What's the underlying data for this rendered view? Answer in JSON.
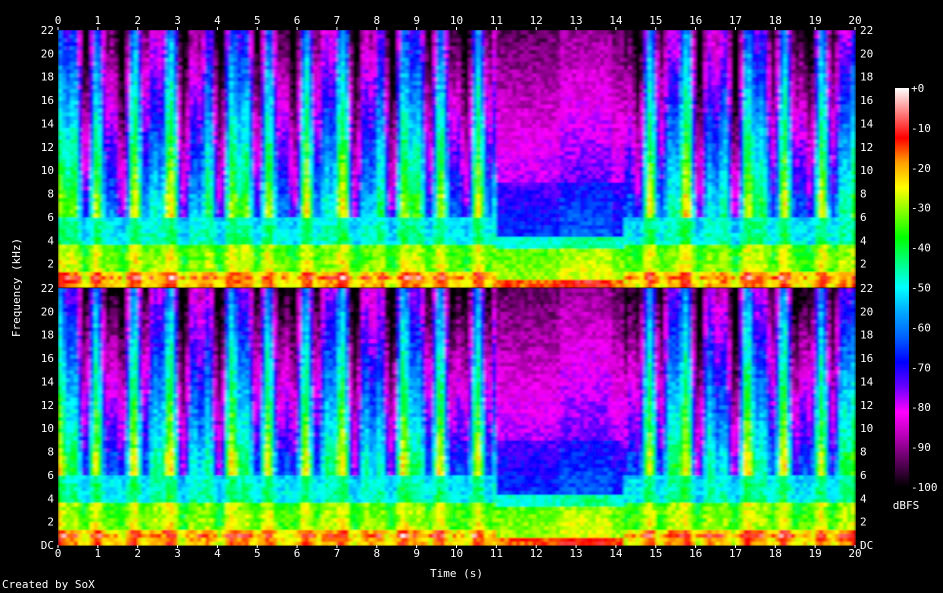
{
  "credit": "Created by SoX",
  "chart_data": {
    "type": "heatmap",
    "subtype": "spectrogram",
    "channels": 2,
    "xlabel": "Time (s)",
    "ylabel": "Frequency (kHz)",
    "xlim": [
      0,
      20
    ],
    "ylim": [
      0,
      22
    ],
    "x_ticks": [
      "0",
      "1",
      "2",
      "3",
      "4",
      "5",
      "6",
      "7",
      "8",
      "9",
      "10",
      "11",
      "12",
      "13",
      "14",
      "15",
      "16",
      "17",
      "18",
      "19",
      "20"
    ],
    "y_ticks": [
      "DC",
      "2",
      "4",
      "6",
      "8",
      "10",
      "12",
      "14",
      "16",
      "18",
      "20",
      "22"
    ],
    "colorbar": {
      "label": "dBFS",
      "range": [
        -100,
        0
      ],
      "ticks": [
        "+0",
        "-10",
        "-20",
        "-30",
        "-40",
        "-50",
        "-60",
        "-70",
        "-80",
        "-90",
        "-100"
      ],
      "colors": [
        "#000000",
        "#5a005a",
        "#b400b4",
        "#ff00ff",
        "#6a00ff",
        "#0000ff",
        "#0060ff",
        "#00a8ff",
        "#00ffff",
        "#00ff80",
        "#00ff00",
        "#80ff00",
        "#ffff00",
        "#ffa000",
        "#ff0000",
        "#ff8080",
        "#ffffff"
      ]
    },
    "segments": [
      {
        "t_start": 0,
        "t_end": 11.0,
        "texture": "speech"
      },
      {
        "t_start": 11.0,
        "t_end": 14.2,
        "texture": "tonal"
      },
      {
        "t_start": 14.2,
        "t_end": 20,
        "texture": "speech"
      }
    ]
  }
}
